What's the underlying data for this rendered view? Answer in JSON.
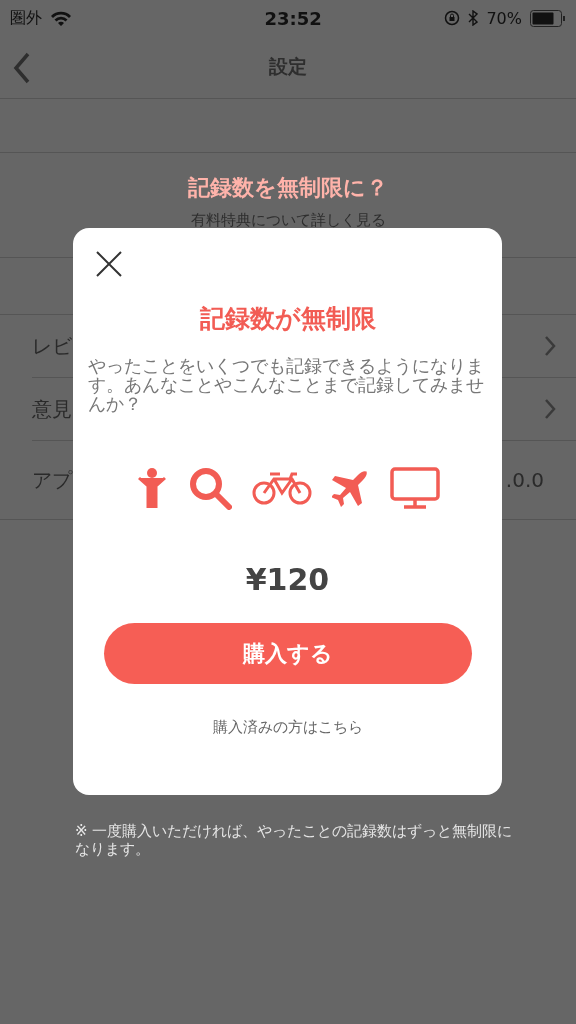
{
  "status_bar": {
    "carrier": "圏外",
    "time": "23:52",
    "battery": "70%"
  },
  "nav": {
    "title": "設定"
  },
  "promo": {
    "title": "記録数を無制限に？",
    "link": "有料特典について詳しく見る"
  },
  "rows": [
    {
      "kind": "link",
      "label": "レビ"
    },
    {
      "kind": "link",
      "label": "意見"
    },
    {
      "kind": "value",
      "label": "アプ",
      "value": ".0.0"
    }
  ],
  "footnote": "※ 一度購入いただければ、やったことの記録数はずっと無制限になります。",
  "modal": {
    "title": "記録数が無制限",
    "description": "やったことをいくつでも記録できるようになります。あんなことやこんなことまで記録してみませんか？",
    "icons": [
      {
        "kind": "person"
      },
      {
        "kind": "search"
      },
      {
        "kind": "bicycle"
      },
      {
        "kind": "airplane"
      },
      {
        "kind": "monitor"
      }
    ],
    "price": "¥120",
    "buy_button": "購入する",
    "restore_link": "購入済みの方はこちら"
  }
}
